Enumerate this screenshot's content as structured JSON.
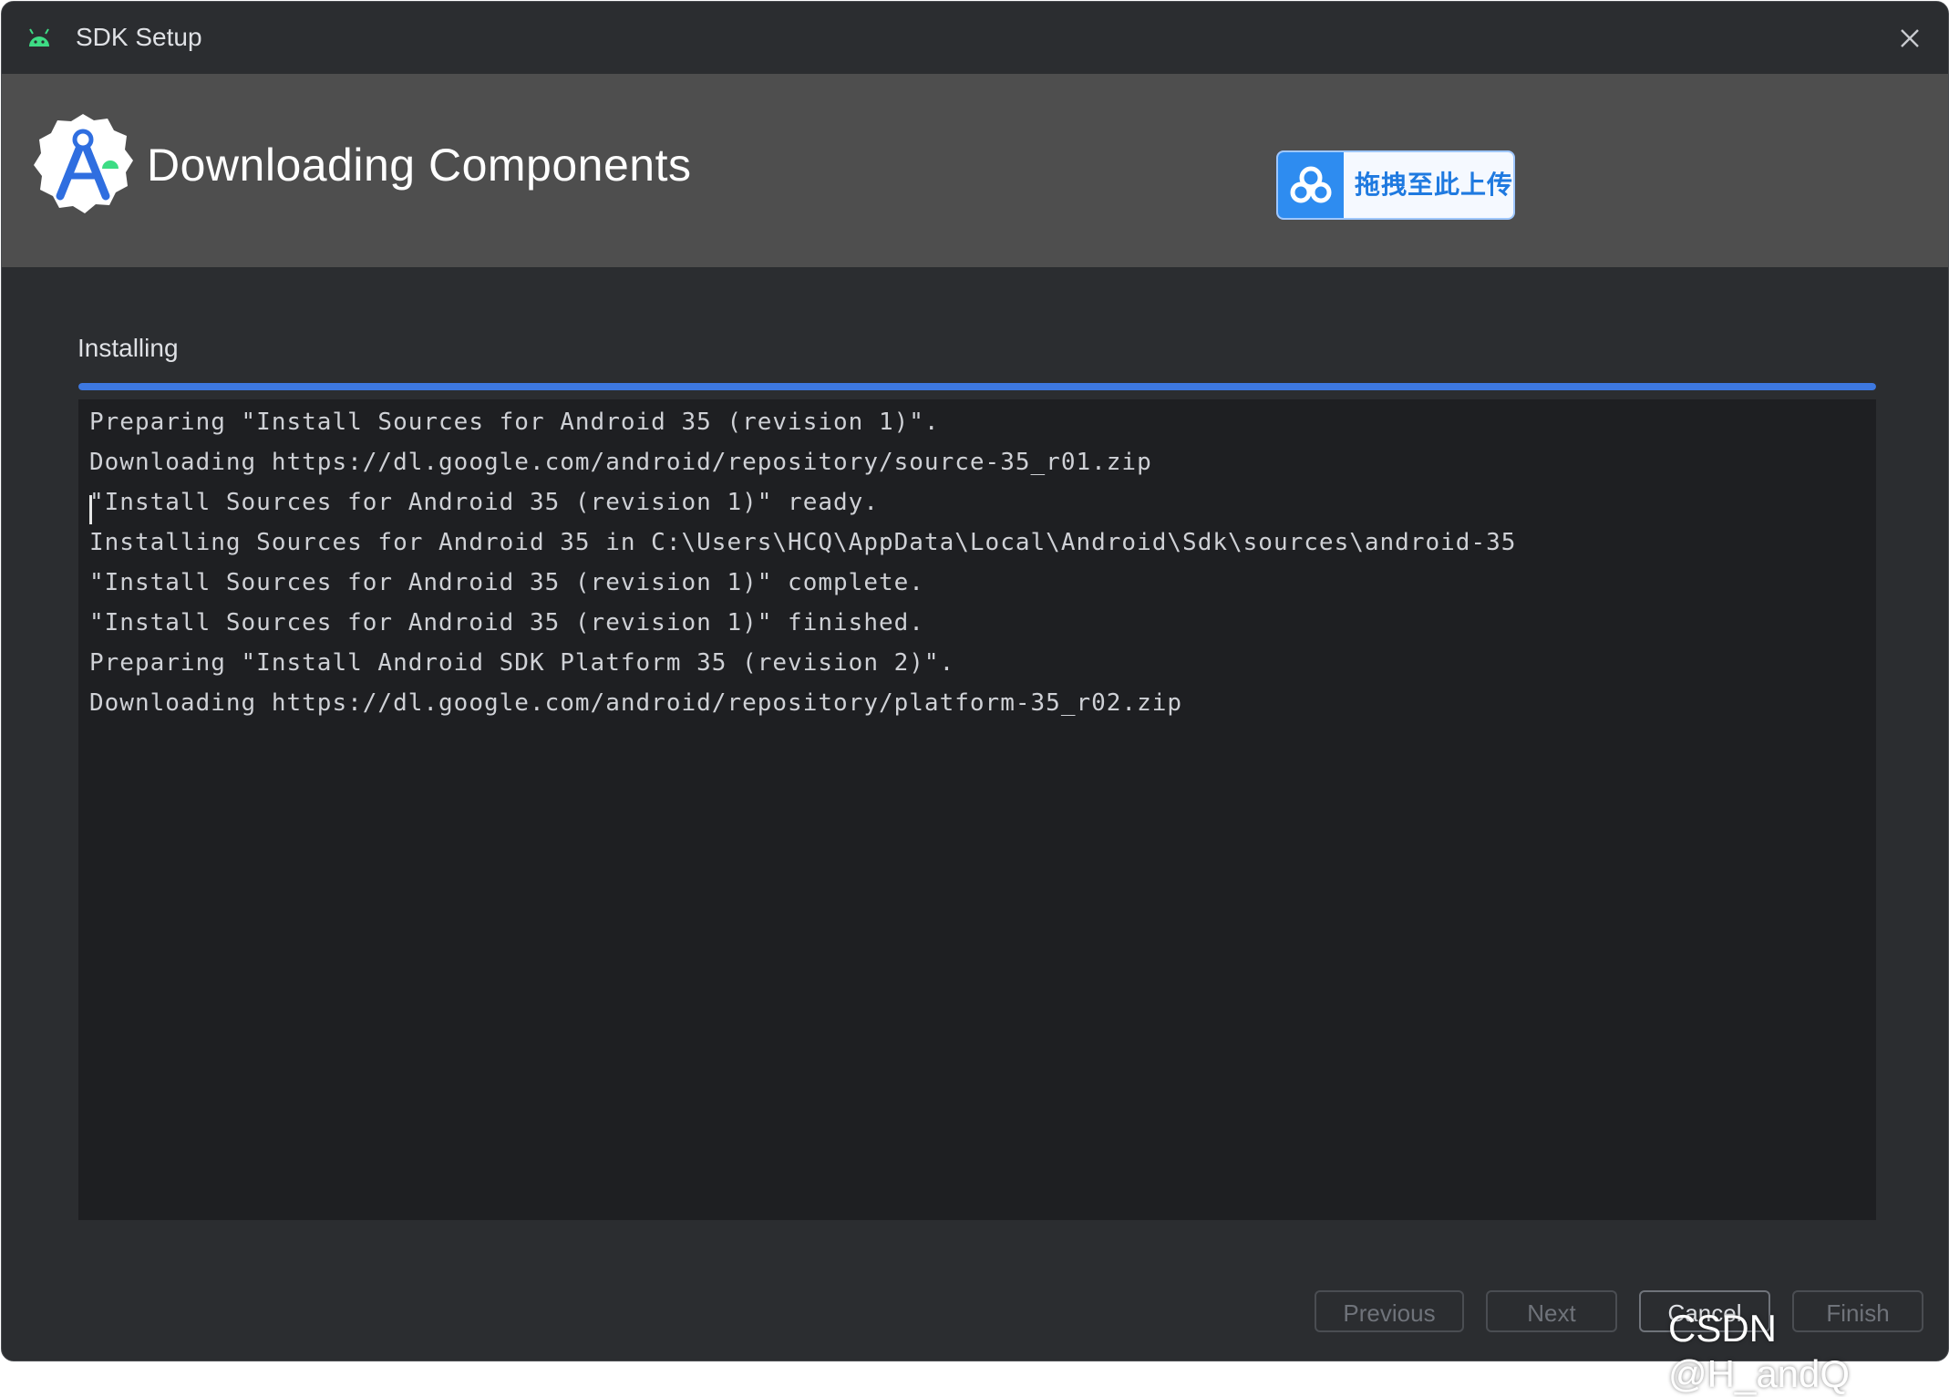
{
  "window": {
    "title": "SDK Setup",
    "app_icon": "android-icon",
    "close_icon": "close-icon"
  },
  "header": {
    "title": "Downloading Components",
    "logo_icon": "android-studio-logo",
    "upload_widget": {
      "label": "拖拽至此上传",
      "icon": "cloud-upload-icon"
    }
  },
  "main": {
    "section_label": "Installing",
    "progress": 1.0,
    "console_lines": [
      "Preparing \"Install Sources for Android 35 (revision 1)\".",
      "Downloading https://dl.google.com/android/repository/source-35_r01.zip",
      "\"Install Sources for Android 35 (revision 1)\" ready.",
      "Installing Sources for Android 35 in C:\\Users\\HCQ\\AppData\\Local\\Android\\Sdk\\sources\\android-35",
      "\"Install Sources for Android 35 (revision 1)\" complete.",
      "\"Install Sources for Android 35 (revision 1)\" finished.",
      "Preparing \"Install Android SDK Platform 35 (revision 2)\".",
      "Downloading https://dl.google.com/android/repository/platform-35_r02.zip"
    ]
  },
  "footer": {
    "previous_label": "Previous",
    "next_label": "Next",
    "cancel_label": "Cancel",
    "finish_label": "Finish"
  },
  "watermark": "CSDN @H_andQ",
  "colors": {
    "background": "#2b2d30",
    "header_bg": "#4e4e4e",
    "console_bg": "#1e1f22",
    "progress": "#3d78e0",
    "upload_accent": "#2e8cf0"
  }
}
